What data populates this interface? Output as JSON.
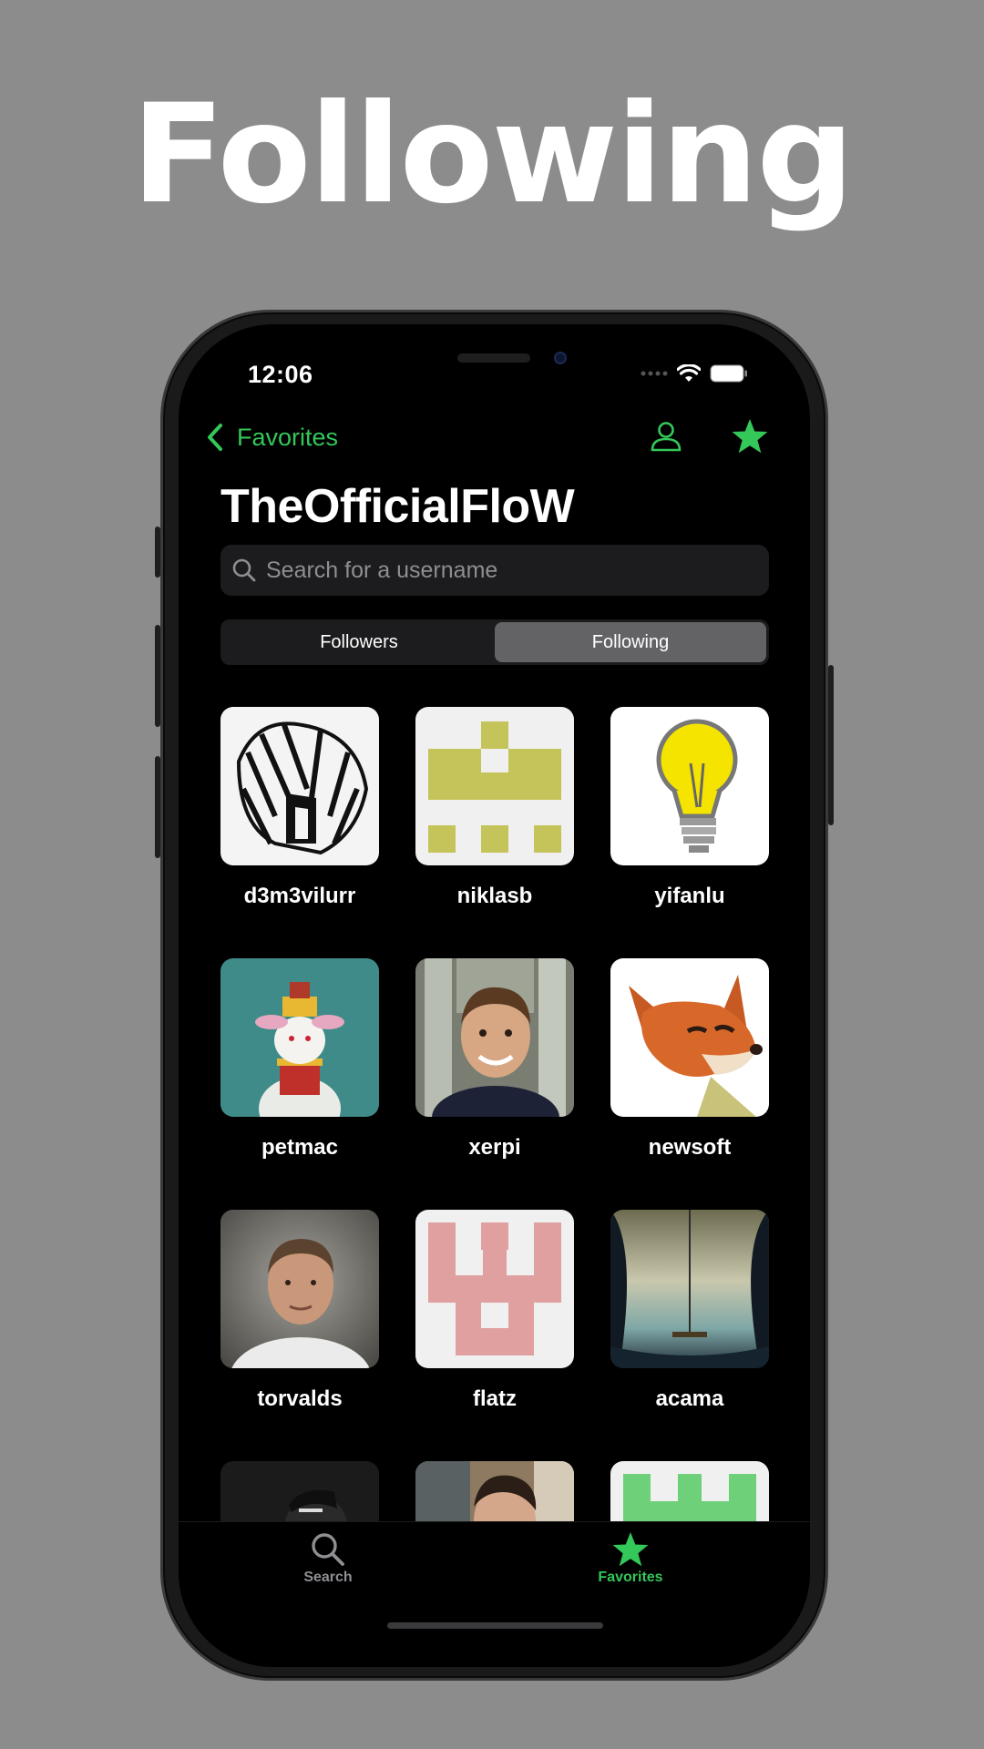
{
  "headline": "Following",
  "status": {
    "time": "12:06"
  },
  "nav": {
    "back_label": "Favorites"
  },
  "title": "TheOfficialFloW",
  "search": {
    "placeholder": "Search for a username"
  },
  "segments": {
    "followers": "Followers",
    "following": "Following",
    "selected": "Following"
  },
  "users": [
    {
      "name": "d3m3vilurr"
    },
    {
      "name": "niklasb"
    },
    {
      "name": "yifanlu"
    },
    {
      "name": "petmac"
    },
    {
      "name": "xerpi"
    },
    {
      "name": "newsoft"
    },
    {
      "name": "torvalds"
    },
    {
      "name": "flatz"
    },
    {
      "name": "acama"
    }
  ],
  "tabbar": {
    "search_label": "Search",
    "favorites_label": "Favorites",
    "selected": "Favorites"
  },
  "colors": {
    "accent": "#34c759",
    "background": "#8c8c8c",
    "screen": "#000000"
  }
}
